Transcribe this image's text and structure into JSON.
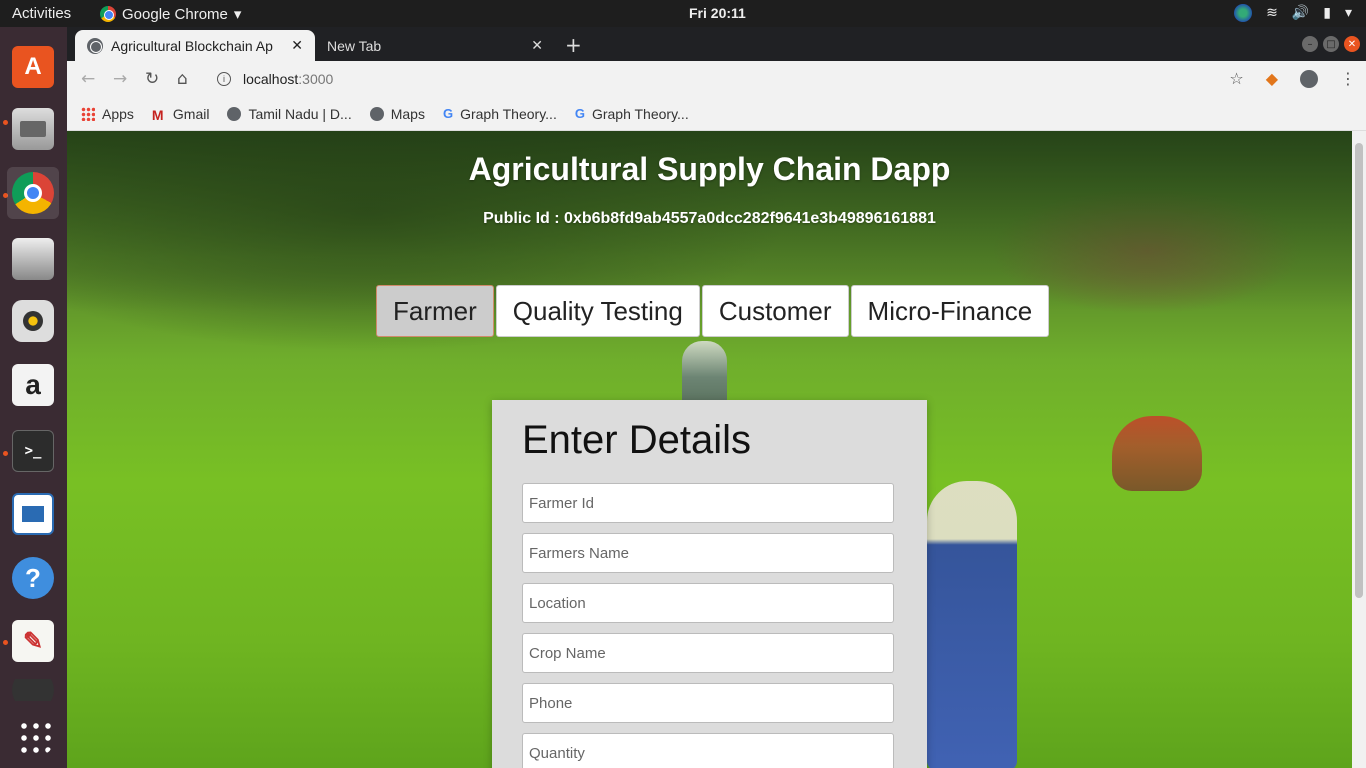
{
  "system": {
    "activities": "Activities",
    "app_menu": "Google Chrome",
    "clock": "Fri 20:11"
  },
  "dock": {
    "apps": [
      "ubuntu-software-icon",
      "files-icon",
      "chrome-icon",
      "scanner-icon",
      "rhythmbox-icon",
      "amazon-icon",
      "terminal-icon",
      "writer-icon",
      "help-icon",
      "text-editor-icon",
      "show-apps-icon"
    ]
  },
  "browser": {
    "tabs": [
      {
        "title": "Agricultural Blockchain Ap",
        "active": true
      },
      {
        "title": "New Tab",
        "active": false
      }
    ],
    "url_host": "localhost",
    "url_port": ":3000",
    "bookmarks": [
      {
        "label": "Apps",
        "icon": "apps-grid-icon"
      },
      {
        "label": "Gmail",
        "icon": "gmail-icon"
      },
      {
        "label": "Tamil Nadu | D...",
        "icon": "globe-icon"
      },
      {
        "label": "Maps",
        "icon": "globe-icon"
      },
      {
        "label": "Graph Theory...",
        "icon": "google-icon"
      },
      {
        "label": "Graph Theory...",
        "icon": "google-icon"
      }
    ]
  },
  "page": {
    "title": "Agricultural Supply Chain Dapp",
    "public_id": "Public Id : 0xb6b8fd9ab4557a0dcc282f9641e3b49896161881",
    "role_tabs": [
      "Farmer",
      "Quality Testing",
      "Customer",
      "Micro-Finance"
    ],
    "active_role": "Farmer",
    "form": {
      "heading": "Enter Details",
      "fields": [
        {
          "placeholder": "Farmer Id"
        },
        {
          "placeholder": "Farmers Name"
        },
        {
          "placeholder": "Location"
        },
        {
          "placeholder": "Crop Name"
        },
        {
          "placeholder": "Phone"
        },
        {
          "placeholder": "Quantity"
        }
      ]
    }
  },
  "colors": {
    "accent": "#e95420",
    "card_bg": "#dcdcdc"
  }
}
